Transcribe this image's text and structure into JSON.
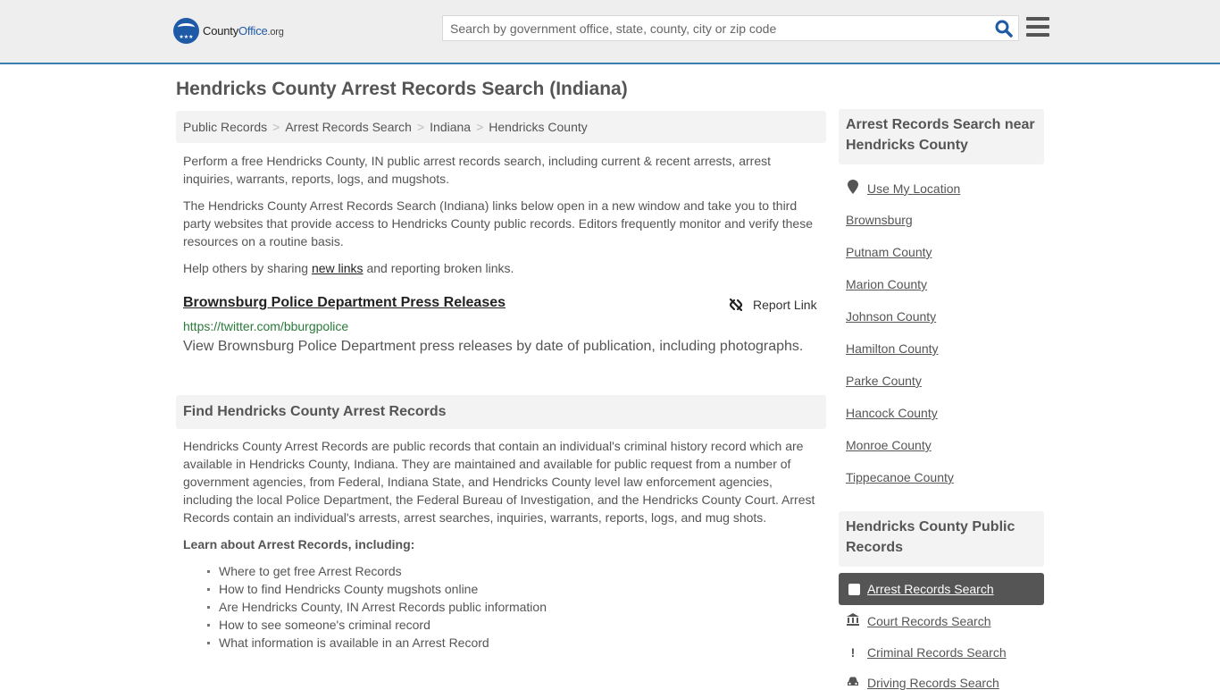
{
  "header": {
    "logo": {
      "name_part1": "County",
      "name_part2": "Office",
      "name_part3": ".org",
      "stars": "★★★"
    },
    "search": {
      "placeholder": "Search by government office, state, county, city or zip code",
      "value": ""
    }
  },
  "page_title": "Hendricks County Arrest Records Search (Indiana)",
  "breadcrumb": [
    "Public Records",
    "Arrest Records Search",
    "Indiana",
    "Hendricks County"
  ],
  "breadcrumb_sep": ">",
  "intro": {
    "p1": "Perform a free Hendricks County, IN public arrest records search, including current & recent arrests, arrest inquiries, warrants, reports, logs, and mugshots.",
    "p2": "The Hendricks County Arrest Records Search (Indiana) links below open in a new window and take you to third party websites that provide access to Hendricks County public records. Editors frequently monitor and verify these resources on a routine basis.",
    "p3_before": "Help others by sharing ",
    "p3_link": "new links",
    "p3_after": " and reporting broken links."
  },
  "result": {
    "title": "Brownsburg Police Department Press Releases",
    "report_label": "Report Link",
    "url": "https://twitter.com/bburgpolice",
    "description": "View Brownsburg Police Department press releases by date of publication, including photographs."
  },
  "find_section": {
    "heading": "Find Hendricks County Arrest Records",
    "body": "Hendricks County Arrest Records are public records that contain an individual's criminal history record which are available in Hendricks County, Indiana. They are maintained and available for public request from a number of government agencies, from Federal, Indiana State, and Hendricks County level law enforcement agencies, including the local Police Department, the Federal Bureau of Investigation, and the Hendricks County Court. Arrest Records contain an individual's arrests, arrest searches, inquiries, warrants, reports, logs, and mug shots.",
    "learn_heading": "Learn about Arrest Records, including:",
    "learn_items": [
      "Where to get free Arrest Records",
      "How to find Hendricks County mugshots online",
      "Are Hendricks County, IN Arrest Records public information",
      "How to see someone's criminal record",
      "What information is available in an Arrest Record"
    ]
  },
  "sidebar": {
    "nearby_heading": "Arrest Records Search near Hendricks County",
    "use_location": "Use My Location",
    "nearby_links": [
      "Brownsburg",
      "Putnam County",
      "Marion County",
      "Johnson County",
      "Hamilton County",
      "Parke County",
      "Hancock County",
      "Monroe County",
      "Tippecanoe County"
    ],
    "records_heading": "Hendricks County Public Records",
    "records_links": [
      {
        "label": "Arrest Records Search",
        "icon": "square-icon",
        "active": true
      },
      {
        "label": "Court Records Search",
        "icon": "courthouse-icon",
        "active": false
      },
      {
        "label": "Criminal Records Search",
        "icon": "exclamation-icon",
        "active": false
      },
      {
        "label": "Driving Records Search",
        "icon": "car-icon",
        "active": false
      }
    ]
  },
  "colors": {
    "accent_blue": "#3a7fb0",
    "brand_blue": "#1f5aa6",
    "url_green": "#2a7a3a",
    "active_bg": "#555555"
  }
}
